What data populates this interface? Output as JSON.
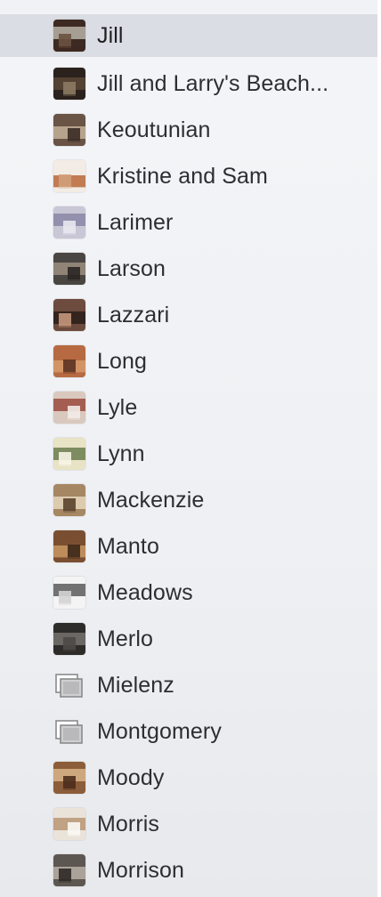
{
  "sidebar": {
    "items": [
      {
        "label": "Jill",
        "icon": "photo-thumbnail-icon",
        "selected": true,
        "colors": [
          "#3d2a22",
          "#b9b3a6",
          "#6b5140"
        ]
      },
      {
        "label": "Jill and Larry's Beach...",
        "icon": "photo-thumbnail-icon",
        "selected": false,
        "colors": [
          "#2c221d",
          "#5a4636",
          "#8c7a63"
        ]
      },
      {
        "label": "Keoutunian",
        "icon": "photo-thumbnail-icon",
        "selected": false,
        "colors": [
          "#6a5446",
          "#c3b19a",
          "#3a2c25"
        ]
      },
      {
        "label": "Kristine and Sam",
        "icon": "photo-thumbnail-icon",
        "selected": false,
        "colors": [
          "#f2ece5",
          "#b8683a",
          "#d1a07a"
        ]
      },
      {
        "label": "Larimer",
        "icon": "photo-thumbnail-icon",
        "selected": false,
        "colors": [
          "#c9c6d6",
          "#8a86a6",
          "#e9e7ef"
        ]
      },
      {
        "label": "Larson",
        "icon": "photo-thumbnail-icon",
        "selected": false,
        "colors": [
          "#4a4643",
          "#9c8f80",
          "#2a2523"
        ]
      },
      {
        "label": "Lazzari",
        "icon": "photo-thumbnail-icon",
        "selected": false,
        "colors": [
          "#6d4b3e",
          "#2a1d19",
          "#c5967b"
        ]
      },
      {
        "label": "Long",
        "icon": "photo-thumbnail-icon",
        "selected": false,
        "colors": [
          "#b76a41",
          "#d79b6c",
          "#5b3322"
        ]
      },
      {
        "label": "Lyle",
        "icon": "photo-thumbnail-icon",
        "selected": false,
        "colors": [
          "#d9c8bd",
          "#9b4a3f",
          "#f2ebe6"
        ]
      },
      {
        "label": "Lynn",
        "icon": "photo-thumbnail-icon",
        "selected": false,
        "colors": [
          "#e8e3c5",
          "#6b7c4f",
          "#f7f4e6"
        ]
      },
      {
        "label": "Mackenzie",
        "icon": "photo-thumbnail-icon",
        "selected": false,
        "colors": [
          "#a68763",
          "#e6d7bd",
          "#5a432c"
        ]
      },
      {
        "label": "Manto",
        "icon": "photo-thumbnail-icon",
        "selected": false,
        "colors": [
          "#7a4f31",
          "#c89763",
          "#3b2618"
        ]
      },
      {
        "label": "Meadows",
        "icon": "photo-thumbnail-icon",
        "selected": false,
        "colors": [
          "#f4f4f4",
          "#5a5a5a",
          "#d4d4d4"
        ]
      },
      {
        "label": "Merlo",
        "icon": "photo-thumbnail-icon",
        "selected": false,
        "colors": [
          "#2e2c2a",
          "#76726d",
          "#4c4946"
        ]
      },
      {
        "label": "Mielenz",
        "icon": "stack-placeholder-icon",
        "selected": false,
        "colors": [
          "#8a8a8c",
          "#cfcfd2",
          "#ffffff"
        ]
      },
      {
        "label": "Montgomery",
        "icon": "stack-placeholder-icon",
        "selected": false,
        "colors": [
          "#8a8a8c",
          "#cfcfd2",
          "#ffffff"
        ]
      },
      {
        "label": "Moody",
        "icon": "photo-thumbnail-icon",
        "selected": false,
        "colors": [
          "#8c5d3a",
          "#d8b48a",
          "#4b2e1c"
        ]
      },
      {
        "label": "Morris",
        "icon": "photo-thumbnail-icon",
        "selected": false,
        "colors": [
          "#eae3da",
          "#b99674",
          "#fbf8f4"
        ]
      },
      {
        "label": "Morrison",
        "icon": "photo-thumbnail-icon",
        "selected": false,
        "colors": [
          "#5d5752",
          "#b8afa6",
          "#2d2926"
        ]
      }
    ]
  },
  "colors": {
    "selected_row": "#dadde3",
    "label_text": "#2d2e31"
  }
}
